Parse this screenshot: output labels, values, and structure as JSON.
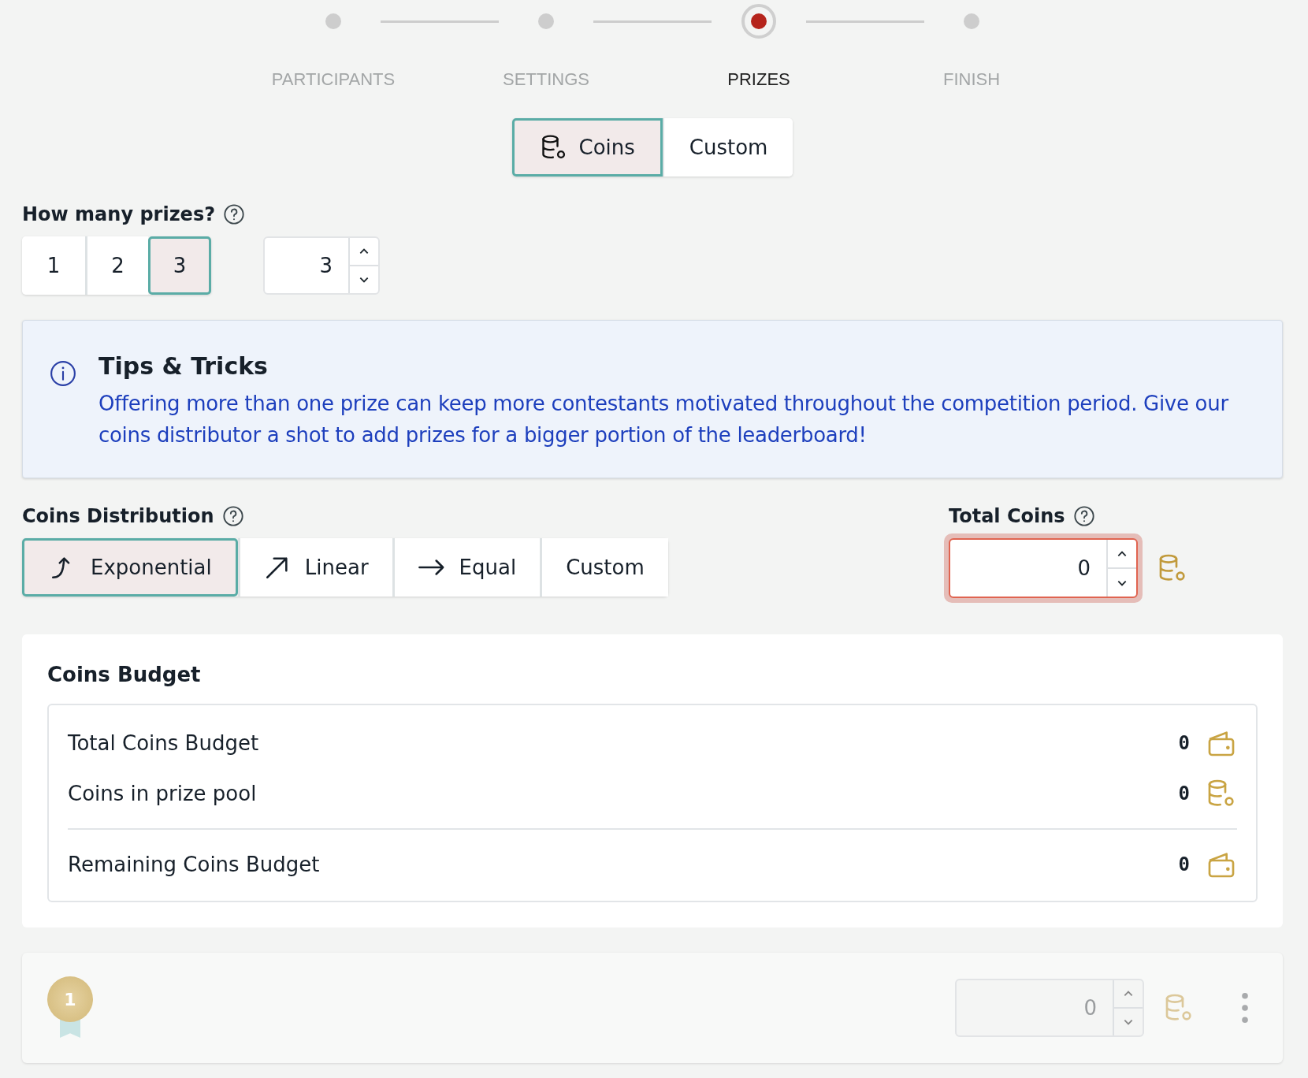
{
  "steps": [
    {
      "label": "PARTICIPANTS",
      "selected": false
    },
    {
      "label": "SETTINGS",
      "selected": false
    },
    {
      "label": "PRIZES",
      "selected": true
    },
    {
      "label": "FINISH",
      "selected": false
    }
  ],
  "prize_type": [
    {
      "label": "Coins",
      "kind": "coins",
      "selected": true
    },
    {
      "label": "Custom",
      "kind": "plain",
      "selected": false
    }
  ],
  "prize_count": {
    "label": "How many prizes?",
    "options": [
      {
        "label": "1",
        "selected": false
      },
      {
        "label": "2",
        "selected": false
      },
      {
        "label": "3",
        "selected": true
      }
    ],
    "value": "3"
  },
  "tips": {
    "title": "Tips & Tricks",
    "text": "Offering more than one prize can keep more contestants motivated throughout the competition period. Give our coins distributor a shot to add prizes for a bigger portion of the leaderboard!"
  },
  "distribution": {
    "label": "Coins Distribution",
    "options": [
      {
        "label": "Exponential",
        "kind": "exponential",
        "selected": true
      },
      {
        "label": "Linear",
        "kind": "linear",
        "selected": false
      },
      {
        "label": "Equal",
        "kind": "equal",
        "selected": false
      },
      {
        "label": "Custom",
        "kind": "custom",
        "selected": false
      }
    ]
  },
  "total_coins": {
    "label": "Total Coins",
    "value": "0",
    "invalid": true
  },
  "budget": {
    "title": "Coins Budget",
    "groups": [
      [
        {
          "label": "Total Coins Budget",
          "value": "0",
          "kind": "wallet"
        },
        {
          "label": "Coins in prize pool",
          "value": "0",
          "kind": "coins"
        }
      ],
      [
        {
          "label": "Remaining Coins Budget",
          "value": "0",
          "kind": "wallet"
        }
      ]
    ]
  },
  "prizes": [
    {
      "rank": "1",
      "value": "0",
      "disabled": true
    }
  ]
}
